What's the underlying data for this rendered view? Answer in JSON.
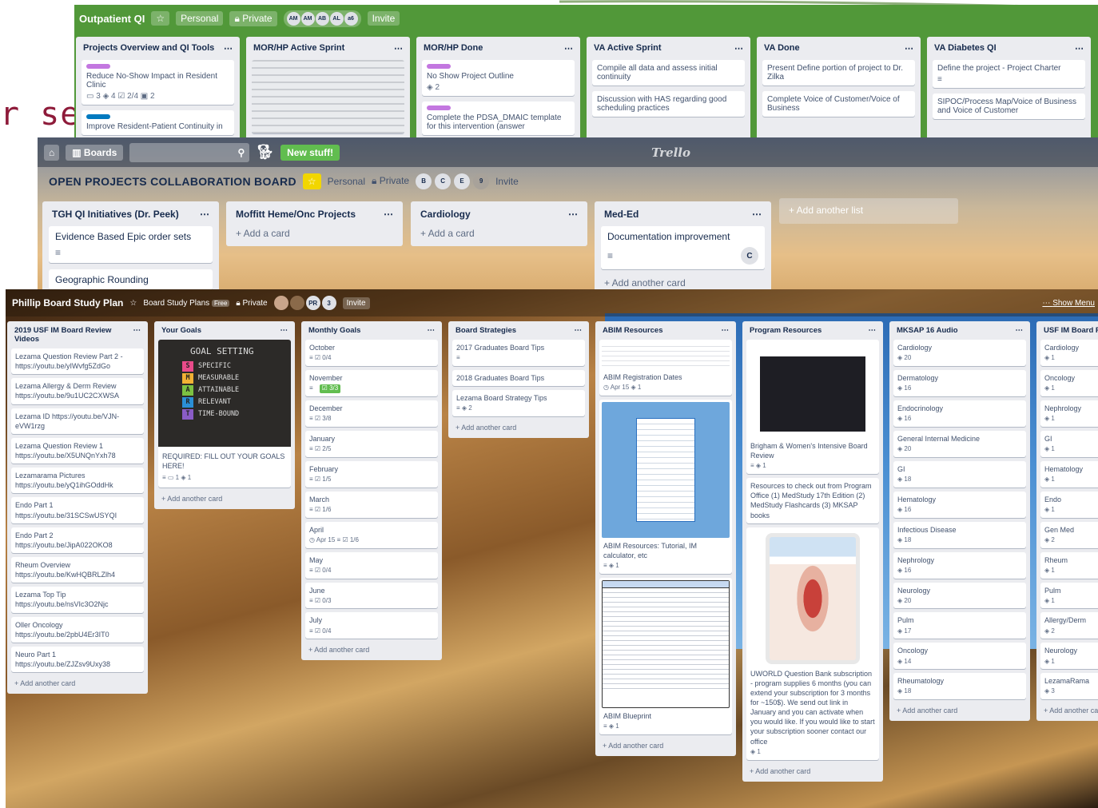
{
  "slide": {
    "fragment": "r se"
  },
  "outpatient": {
    "title": "Outpatient QI",
    "star": "☆",
    "team": "Personal",
    "visibility": "Private",
    "members": [
      "AM",
      "AM",
      "AB",
      "AL",
      "a6"
    ],
    "invite": "Invite",
    "lists": [
      {
        "title": "Projects Overview and QI Tools",
        "cards": [
          {
            "text": "Reduce No-Show Impact in Resident Clinic",
            "label": "#c377e0",
            "meta": "▭ 3   ◈ 4   ☑ 2/4   ▣ 2"
          },
          {
            "text": "Improve Resident-Patient Continuity in",
            "label": "#0079bf",
            "meta": ""
          }
        ]
      },
      {
        "title": "MOR/HP Active Sprint",
        "cards": [
          {
            "text": "",
            "label": "",
            "meta": "",
            "image": true
          }
        ]
      },
      {
        "title": "MOR/HP Done",
        "cards": [
          {
            "text": "No Show Project Outline",
            "label": "#c377e0",
            "meta": "◈ 2"
          },
          {
            "text": "Complete the PDSA_DMAIC template for this intervention (answer",
            "label": "#c377e0",
            "meta": ""
          }
        ]
      },
      {
        "title": "VA Active Sprint",
        "cards": [
          {
            "text": "Compile all data and assess initial continuity",
            "label": "",
            "meta": ""
          },
          {
            "text": "Discussion with HAS regarding good scheduling practices",
            "label": "",
            "meta": ""
          }
        ]
      },
      {
        "title": "VA Done",
        "cards": [
          {
            "text": "Present Define portion of project to Dr. Zilka",
            "label": "",
            "meta": ""
          },
          {
            "text": "Complete Voice of Customer/Voice of Business",
            "label": "",
            "meta": ""
          }
        ]
      },
      {
        "title": "VA Diabetes QI",
        "cards": [
          {
            "text": "Define the project - Project Charter",
            "label": "",
            "meta": "≡"
          },
          {
            "text": "SIPOC/Process Map/Voice of Business and Voice of Customer",
            "label": "",
            "meta": ""
          }
        ]
      }
    ]
  },
  "collab": {
    "topbar": {
      "home": "⌂",
      "boards": "Boards",
      "new_stuff": "New stuff!",
      "logo": "Trello"
    },
    "title": "OPEN PROJECTS COLLABORATION BOARD",
    "team": "Personal",
    "visibility": "Private",
    "members": [
      "B",
      "C",
      "E",
      "9"
    ],
    "invite": "Invite",
    "add_list": "+ Add another list",
    "lists": [
      {
        "title": "TGH QI Initiatives (Dr. Peek)",
        "cards": [
          "Evidence Based Epic order sets",
          "Geographic Rounding"
        ],
        "add": ""
      },
      {
        "title": "Moffitt Heme/Onc Projects",
        "cards": [],
        "add": "+ Add a card"
      },
      {
        "title": "Cardiology",
        "cards": [],
        "add": "+ Add a card"
      },
      {
        "title": "Med-Ed",
        "cards": [
          "Documentation improvement"
        ],
        "member": "C",
        "add": "+ Add another card"
      }
    ]
  },
  "study": {
    "title": "Phillip Board Study Plan",
    "team": "Board Study Plans",
    "team_badge": "Free",
    "visibility": "Private",
    "members": [
      "PR",
      "3"
    ],
    "invite": "Invite",
    "show_menu": "Show Menu",
    "add_card": "+ Add another card",
    "lists": [
      {
        "title": "2019 USF IM Board Review Videos",
        "cards": [
          {
            "text": "Lezama Question Review Part 2 - https://youtu.be/yIWvfg5ZdGo"
          },
          {
            "text": "Lezama Allergy & Derm Review https://youtu.be/9u1UC2CXWSA"
          },
          {
            "text": "Lezama ID https://youtu.be/VJN-eVW1rzg"
          },
          {
            "text": "Lezama Question Review 1 https://youtu.be/X5UNQnYxh78"
          },
          {
            "text": "Lezamarama Pictures https://youtu.be/yQ1ihGOddHk"
          },
          {
            "text": "Endo Part 1 https://youtu.be/31SCSwUSYQI"
          },
          {
            "text": "Endo Part 2 https://youtu.be/JipA022OKO8"
          },
          {
            "text": "Rheum Overview https://youtu.be/KwHQBRLZlh4"
          },
          {
            "text": "Lezama Top Tip https://youtu.be/nsVIc3O2Njc"
          },
          {
            "text": "Oller Oncology https://youtu.be/2pbU4Er3IT0"
          },
          {
            "text": "Neuro Part 1 https://youtu.be/ZJZsv9Uxy38"
          }
        ]
      },
      {
        "title": "Your Goals",
        "goal_card": {
          "heading": "GOAL SETTING",
          "rows": [
            [
              "S",
              "SPECIFIC",
              "#e94b8a"
            ],
            [
              "M",
              "MEASURABLE",
              "#f2b134"
            ],
            [
              "A",
              "ATTAINABLE",
              "#7cc142"
            ],
            [
              "R",
              "RELEVANT",
              "#2b8fd6"
            ],
            [
              "T",
              "TIME-BOUND",
              "#8a5cc7"
            ]
          ],
          "text": "REQUIRED: FILL OUT YOUR GOALS HERE!",
          "meta": "≡  ▭ 1  ◈ 1"
        }
      },
      {
        "title": "Monthly Goals",
        "cards": [
          {
            "text": "October",
            "meta": "≡  ☑ 0/4"
          },
          {
            "text": "November",
            "meta": "≡  ☑ 3/3",
            "done": true
          },
          {
            "text": "December",
            "meta": "≡  ☑ 3/8"
          },
          {
            "text": "January",
            "meta": "≡  ☑ 2/5"
          },
          {
            "text": "February",
            "meta": "≡  ☑ 1/5"
          },
          {
            "text": "March",
            "meta": "≡  ☑ 1/6"
          },
          {
            "text": "April",
            "meta": "◷ Apr 15  ≡  ☑ 1/6"
          },
          {
            "text": "May",
            "meta": "≡  ☑ 0/4"
          },
          {
            "text": "June",
            "meta": "≡  ☑ 0/3"
          },
          {
            "text": "July",
            "meta": "≡  ☑ 0/4"
          }
        ]
      },
      {
        "title": "Board Strategies",
        "cards": [
          {
            "text": "2017 Graduates Board Tips",
            "meta": "≡"
          },
          {
            "text": "2018 Graduates Board Tips",
            "meta": ""
          },
          {
            "text": "Lezama Board Strategy Tips",
            "meta": "≡  ◈ 2"
          }
        ]
      },
      {
        "title": "ABIM Resources",
        "cards": [
          {
            "text": "ABIM Registration Dates",
            "meta": "◷ Apr 15  ◈ 1",
            "image": "doc"
          },
          {
            "text": "ABIM Resources: Tutorial, IM calculator, etc",
            "meta": "≡  ◈ 1",
            "image": "blue"
          },
          {
            "text": "ABIM Blueprint",
            "meta": "≡  ◈ 1",
            "image": "table"
          }
        ]
      },
      {
        "title": "Program Resources",
        "cards": [
          {
            "text": "Brigham & Women's Intensive Board Review",
            "meta": "≡  ◈ 1",
            "image": "dark"
          },
          {
            "text": "Resources to check out from Program Office (1) MedStudy 17th Edition (2) MedStudy Flashcards (3) MKSAP books",
            "meta": ""
          },
          {
            "text": "UWORLD Question Bank subscription - program supplies 6 months (you can extend your subscription for 3 months for ~150$). We send out link in January and you can activate when you would like. If you would like to start your subscription sooner contact our office",
            "meta": "◈ 1",
            "image": "tablet"
          }
        ]
      },
      {
        "title": "MKSAP 16 Audio",
        "cards": [
          {
            "text": "Cardiology",
            "meta": "◈ 20"
          },
          {
            "text": "Dermatology",
            "meta": "◈ 16"
          },
          {
            "text": "Endocrinology",
            "meta": "◈ 16"
          },
          {
            "text": "General Internal Medicine",
            "meta": "◈ 20"
          },
          {
            "text": "GI",
            "meta": "◈ 18"
          },
          {
            "text": "Hematology",
            "meta": "◈ 16"
          },
          {
            "text": "Infectious Disease",
            "meta": "◈ 18"
          },
          {
            "text": "Nephrology",
            "meta": "◈ 16"
          },
          {
            "text": "Neurology",
            "meta": "◈ 20"
          },
          {
            "text": "Pulm",
            "meta": "◈ 17"
          },
          {
            "text": "Oncology",
            "meta": "◈ 14"
          },
          {
            "text": "Rheumatology",
            "meta": "◈ 18"
          }
        ]
      },
      {
        "title": "USF IM Board Review",
        "cards": [
          {
            "text": "Cardiology",
            "meta": "◈ 1"
          },
          {
            "text": "Oncology",
            "meta": "◈ 1"
          },
          {
            "text": "Nephrology",
            "meta": "◈ 1"
          },
          {
            "text": "GI",
            "meta": "◈ 1"
          },
          {
            "text": "Hematology",
            "meta": "◈ 1"
          },
          {
            "text": "Endo",
            "meta": "◈ 1"
          },
          {
            "text": "Gen Med",
            "meta": "◈ 2"
          },
          {
            "text": "Rheum",
            "meta": "◈ 1"
          },
          {
            "text": "Pulm",
            "meta": "◈ 1"
          },
          {
            "text": "Allergy/Derm",
            "meta": "◈ 2"
          },
          {
            "text": "Neurology",
            "meta": "◈ 1"
          },
          {
            "text": "LezamaRama",
            "meta": "◈ 3"
          }
        ]
      }
    ]
  },
  "colors": {
    "trello_green": "#519839",
    "accent_purple": "#c377e0",
    "accent_blue": "#0079bf",
    "new_stuff": "#61bd4f",
    "list_bg": "#ebecf0"
  }
}
